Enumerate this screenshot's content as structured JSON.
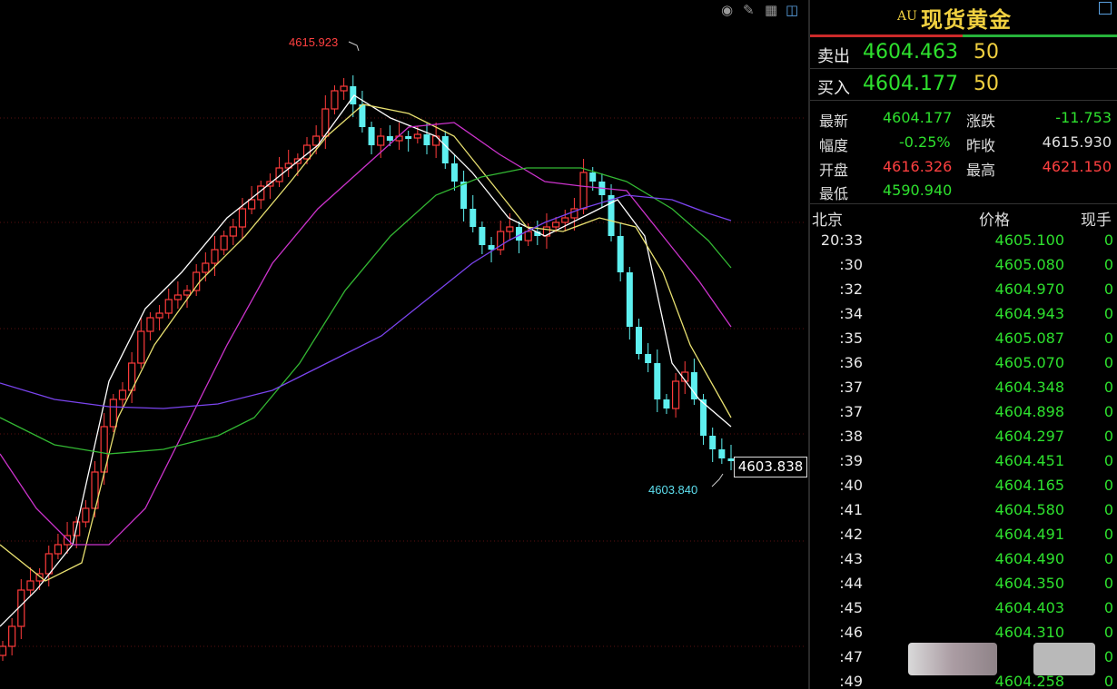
{
  "toolbar": {
    "icons": [
      "eye-icon",
      "pencil-icon",
      "grid-icon",
      "layout-icon"
    ]
  },
  "chart": {
    "high_label": "4615.923",
    "low_label": "4603.840",
    "current_price": "4603.838",
    "colors": {
      "up": "#ff3b3b",
      "down": "#5ef0f0",
      "ma5": "#ffffff",
      "ma10": "#e8e070",
      "ma20": "#cc33cc",
      "ma30": "#33b833",
      "ma60": "#7a44ee",
      "grid": "#5a1010"
    }
  },
  "panel": {
    "code": "AU",
    "name": "现货黄金",
    "sell": {
      "label": "卖出",
      "price": "4604.463",
      "qty": "50"
    },
    "buy": {
      "label": "买入",
      "price": "4604.177",
      "qty": "50"
    },
    "stats": {
      "latest_label": "最新",
      "latest": "4604.177",
      "change_label": "涨跌",
      "change": "-11.753",
      "pct_label": "幅度",
      "pct": "-0.25%",
      "prev_label": "昨收",
      "prev": "4615.930",
      "open_label": "开盘",
      "open": "4616.326",
      "high_label": "最高",
      "high": "4621.150",
      "low_label": "最低",
      "low": "4590.940"
    },
    "header": {
      "time": "北京",
      "price": "价格",
      "vol": "现手"
    },
    "ticks": [
      {
        "time": "20:33",
        "price": "4605.100",
        "vol": "0"
      },
      {
        "time": ":30",
        "price": "4605.080",
        "vol": "0"
      },
      {
        "time": ":32",
        "price": "4604.970",
        "vol": "0"
      },
      {
        "time": ":34",
        "price": "4604.943",
        "vol": "0"
      },
      {
        "time": ":35",
        "price": "4605.087",
        "vol": "0"
      },
      {
        "time": ":36",
        "price": "4605.070",
        "vol": "0"
      },
      {
        "time": ":37",
        "price": "4604.348",
        "vol": "0"
      },
      {
        "time": ":37",
        "price": "4604.898",
        "vol": "0"
      },
      {
        "time": ":38",
        "price": "4604.297",
        "vol": "0"
      },
      {
        "time": ":39",
        "price": "4604.451",
        "vol": "0"
      },
      {
        "time": ":40",
        "price": "4604.165",
        "vol": "0"
      },
      {
        "time": ":41",
        "price": "4604.580",
        "vol": "0"
      },
      {
        "time": ":42",
        "price": "4604.491",
        "vol": "0"
      },
      {
        "time": ":43",
        "price": "4604.490",
        "vol": "0"
      },
      {
        "time": ":44",
        "price": "4604.350",
        "vol": "0"
      },
      {
        "time": ":45",
        "price": "4604.403",
        "vol": "0"
      },
      {
        "time": ":46",
        "price": "4604.310",
        "vol": "0"
      },
      {
        "time": ":47",
        "price": "",
        "vol": "0"
      },
      {
        "time": ":49",
        "price": "4604.258",
        "vol": "0"
      }
    ]
  }
}
